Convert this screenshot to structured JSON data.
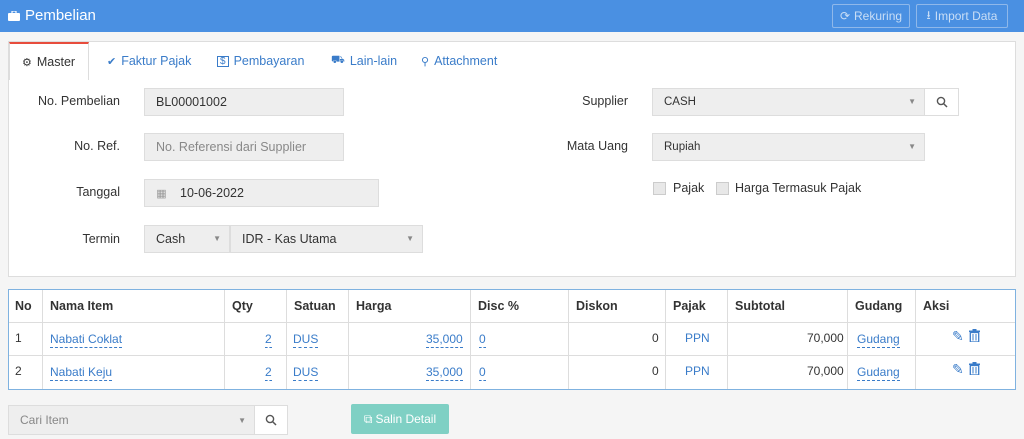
{
  "header": {
    "title": "Pembelian",
    "rekuring_label": "Rekuring",
    "import_label": "Import Data"
  },
  "tabs": [
    {
      "label": "Master"
    },
    {
      "label": "Faktur Pajak"
    },
    {
      "label": "Pembayaran"
    },
    {
      "label": "Lain-lain"
    },
    {
      "label": "Attachment"
    }
  ],
  "form": {
    "no_pembelian_label": "No. Pembelian",
    "no_pembelian_value": "BL00001002",
    "no_ref_label": "No. Ref.",
    "no_ref_placeholder": "No. Referensi dari Supplier",
    "tanggal_label": "Tanggal",
    "tanggal_value": "10-06-2022",
    "termin_label": "Termin",
    "termin_value": "Cash",
    "kas_value": "IDR - Kas Utama",
    "supplier_label": "Supplier",
    "supplier_value": "CASH",
    "mata_uang_label": "Mata Uang",
    "mata_uang_value": "Rupiah",
    "pajak_label": "Pajak",
    "harga_termasuk_pajak_label": "Harga Termasuk Pajak"
  },
  "table": {
    "headers": [
      "No",
      "Nama Item",
      "Qty",
      "Satuan",
      "Harga",
      "Disc %",
      "Diskon",
      "Pajak",
      "Subtotal",
      "Gudang",
      "Aksi"
    ],
    "rows": [
      {
        "no": "1",
        "nama": "Nabati Coklat",
        "qty": "2",
        "satuan": "DUS",
        "harga": "35,000",
        "disc_pct": "0",
        "diskon": "0",
        "pajak": "PPN",
        "subtotal": "70,000",
        "gudang": "Gudang"
      },
      {
        "no": "2",
        "nama": "Nabati Keju",
        "qty": "2",
        "satuan": "DUS",
        "harga": "35,000",
        "disc_pct": "0",
        "diskon": "0",
        "pajak": "PPN",
        "subtotal": "70,000",
        "gudang": "Gudang"
      }
    ]
  },
  "bottom": {
    "search_placeholder": "Cari Item",
    "copy_label": "Salin Detail"
  },
  "colors": {
    "header_bg": "#4a90e2",
    "link": "#3a7cc9",
    "active_tab_border": "#e74c3c",
    "copy_button": "#7fd0c4"
  }
}
